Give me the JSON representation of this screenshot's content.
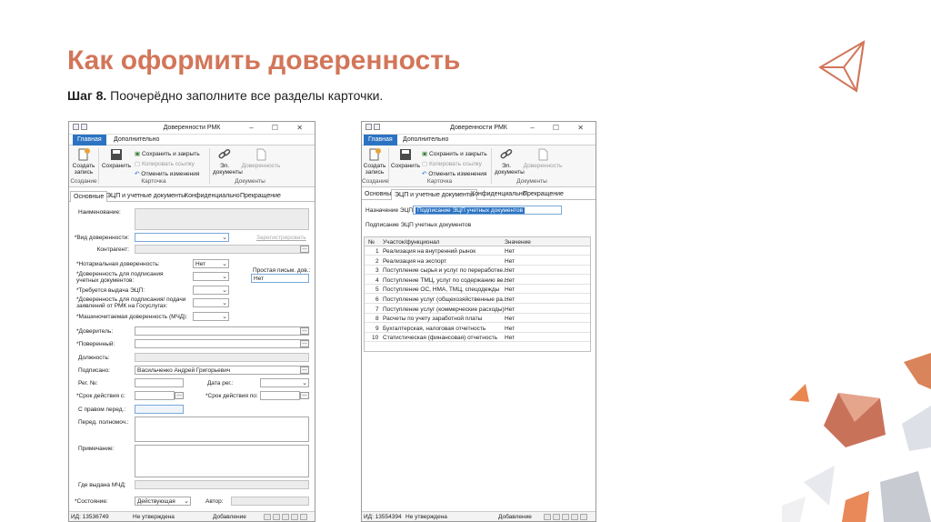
{
  "slide": {
    "title": "Как оформить доверенность",
    "step_bold": "Шаг 8.",
    "step_text": " Поочерёдно заполните все разделы карточки."
  },
  "colors": {
    "accent": "#d2765a",
    "ribbon_active": "#2b73c2"
  },
  "window1": {
    "title": "Доверенности РМК",
    "controls": "–  ☐  ✕",
    "ribbon_tabs": [
      "Главная",
      "Дополнительно"
    ],
    "create_label": "Создать запись",
    "save_label": "Сохранить",
    "save_close": "Сохранить и закрыть",
    "copy_link": "Копировать ссылку",
    "cancel_changes": "Отменить изменения",
    "edocs_label": "Эл. документы",
    "power_label": "Доверенность",
    "group_create": "Создание",
    "group_card": "Карточка",
    "group_docs": "Документы",
    "tabs": [
      "Основные",
      "ЭЦП и учетные документы",
      "Конфиденциально",
      "Прекращение"
    ],
    "fields": {
      "name_label": "Наименование:",
      "type_label": "*Вид доверенности:",
      "register_link": "Зарегистрировать",
      "contragent_label": "Контрагент:",
      "notarial_label": "*Нотариальная доверенность:",
      "notarial_value": "Нет",
      "signing_label": "*Доверенность для подписания учетных документов:",
      "simple_sig_label": "Простая письм. дов.:",
      "simple_sig_value": "Нет",
      "ecp_required_label": "*Требуется выдача ЭЦП:",
      "gosuslugi_label": "*Доверенность для подписания/ подачи заявлений от РМК на Госуслугах:",
      "machine_label": "*Машиночитаемая доверенность (МЧД):",
      "principal_label": "*Доверитель:",
      "attorney_label": "*Поверенный:",
      "position_label": "Должность:",
      "signed_label": "Подписано:",
      "signed_value": "Васильченко Андрей Григорьевич",
      "regno_label": "Рег. №:",
      "regdate_label": "Дата рег.:",
      "valid_from_label": "*Срок действия с:",
      "valid_to_label": "*Срок действия по:",
      "right_label": "С правом перед.:",
      "transfer_label": "Перед. полномоч.:",
      "note_label": "Примечание:",
      "issued_label": "Где выдана МЧД:",
      "state_label": "*Состояние:",
      "state_value": "Действующая",
      "author_label": "Автор:"
    },
    "status": {
      "id": "ИД: 13536749",
      "approval": "Не утверждена",
      "mode": "Добавление"
    }
  },
  "window2": {
    "title": "Доверенности РМК",
    "controls": "–  ☐  ✕",
    "ribbon_tabs": [
      "Главная",
      "Дополнительно"
    ],
    "tabs": [
      "Основные",
      "ЭЦП и учетные документы",
      "Конфиденциально",
      "Прекращение"
    ],
    "ecp_purpose_label": "Назначение ЭЦП:",
    "ecp_purpose_value": "Подписание ЭЦП учетных документов",
    "section_label": "Подписание ЭЦП учетных документов",
    "grid_headers": [
      "№",
      "Участок/функционал",
      "Значение"
    ],
    "rows": [
      {
        "n": "1",
        "name": "Реализация на внутренний рынок",
        "value": "Нет"
      },
      {
        "n": "2",
        "name": "Реализация на экспорт",
        "value": "Нет"
      },
      {
        "n": "3",
        "name": "Поступление сырья и услуг по переработке...",
        "value": "Нет"
      },
      {
        "n": "4",
        "name": "Поступление ТМЦ, услуг по содержанию ве...",
        "value": "Нет"
      },
      {
        "n": "5",
        "name": "Поступление ОС, НМА, ТМЦ, спецодежды",
        "value": "Нет"
      },
      {
        "n": "6",
        "name": "Поступление услуг (общехозяйственные ра...",
        "value": "Нет"
      },
      {
        "n": "7",
        "name": "Поступление услуг (коммерческие расходы)",
        "value": "Нет"
      },
      {
        "n": "8",
        "name": "Расчеты по учету заработной платы",
        "value": "Нет"
      },
      {
        "n": "9",
        "name": "Бухгалтерская, налоговая отчетность",
        "value": "Нет"
      },
      {
        "n": "10",
        "name": "Статистическая (финансовая) отчетность",
        "value": "Нет"
      }
    ],
    "status": {
      "id": "ИД: 13554394",
      "approval": "Не утверждена",
      "mode": "Добавление"
    }
  }
}
